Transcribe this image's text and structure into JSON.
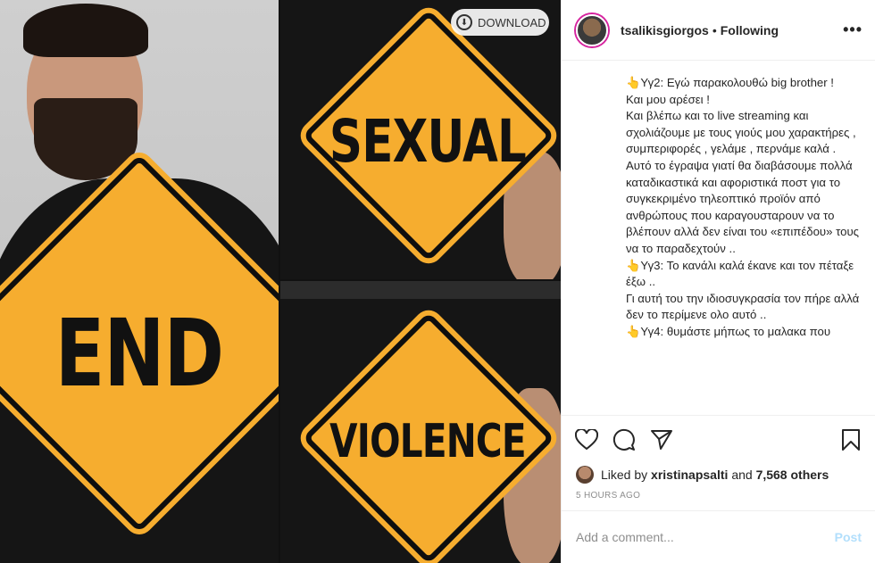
{
  "media": {
    "download_label": "DOWNLOAD",
    "signs": [
      "END",
      "SEXUAL",
      "VIOLENCE"
    ],
    "sign_color": "#f6ad2f"
  },
  "header": {
    "username": "tsalikisgiorgos",
    "separator": "•",
    "follow_status": "Following",
    "more_icon": "ellipsis-icon"
  },
  "caption": {
    "lines": [
      "👆Υγ2: Εγώ παρακολουθώ big brother !",
      "Και μου αρέσει !",
      "Και βλέπω και το live streaming και σχολιάζουμε με τους γιούς μου χαρακτήρες , συμπεριφορές , γελάμε , περνάμε καλά .",
      "Αυτό το έγραψα γιατί θα διαβάσουμε πολλά καταδικαστικά και αφοριστικά ποστ για το συγκεκριμένο τηλεοπτικό προϊόν από ανθρώπους που καραγουσταρουν να το βλέπουν αλλά δεν είναι του «επιπέδου» τους να το παραδεχτούν ..",
      "👆Υγ3: Το κανάλι καλά έκανε και τον πέταξε έξω ..",
      "Γι αυτή του την ιδιοσυγκρασία τον πήρε αλλά δεν το περίμενε ολο αυτό ..",
      "👆Υγ4: θυμάστε μήπως το μαλακα που"
    ]
  },
  "actions": {
    "icons": [
      "heart-icon",
      "comment-icon",
      "share-icon",
      "bookmark-icon"
    ]
  },
  "likes": {
    "prefix": "Liked by",
    "user": "xristinapsalti",
    "middle": "and",
    "count": "7,568 others"
  },
  "timestamp": "5 HOURS AGO",
  "comment": {
    "placeholder": "Add a comment...",
    "post_label": "Post"
  }
}
